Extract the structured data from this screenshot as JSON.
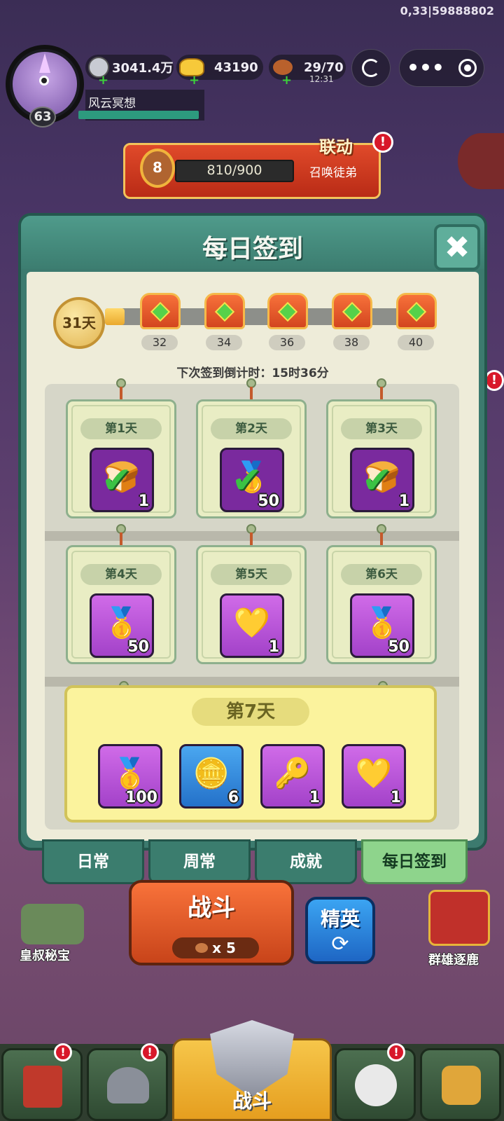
{
  "debug_text": "0,33|59888802",
  "player": {
    "level": "63",
    "name": "风云冥想"
  },
  "resources": {
    "silver": "3041.4万",
    "gold": "43190",
    "stamina": "29/70",
    "stamina_timer": "12:31"
  },
  "banner": {
    "medal_level": "8",
    "progress": "810/900",
    "tag": "联动",
    "action": "召唤徒弟",
    "alert": "!"
  },
  "dialog": {
    "title": "每日签到",
    "close_icon": "✖",
    "streak_days": "31天",
    "chests": [
      "32",
      "34",
      "36",
      "38",
      "40"
    ],
    "countdown": "下次签到倒计时：15时36分",
    "days": [
      {
        "label": "第1天",
        "count": "1",
        "icon": "bread-icon",
        "claimed": true
      },
      {
        "label": "第2天",
        "count": "50",
        "icon": "gold-ingot-icon",
        "claimed": true
      },
      {
        "label": "第3天",
        "count": "1",
        "icon": "bread-icon",
        "claimed": true
      },
      {
        "label": "第4天",
        "count": "50",
        "icon": "gold-ingot-icon",
        "claimed": false
      },
      {
        "label": "第5天",
        "count": "1",
        "icon": "heart-coin-icon",
        "claimed": false
      },
      {
        "label": "第6天",
        "count": "50",
        "icon": "gold-ingot-icon",
        "claimed": false
      }
    ],
    "day7": {
      "label": "第7天",
      "rewards": [
        {
          "icon": "gold-ingot-icon",
          "count": "100"
        },
        {
          "icon": "silver-coin-icon",
          "count": "6"
        },
        {
          "icon": "key-icon",
          "count": "1"
        },
        {
          "icon": "heart-coin-icon",
          "count": "1"
        }
      ]
    }
  },
  "tabs": [
    "日常",
    "周常",
    "成就",
    "每日签到"
  ],
  "active_tab": "每日签到",
  "lower": {
    "fight": "战斗",
    "fight_cost": "x 5",
    "elite": "精英",
    "left_label": "皇叔秘宝",
    "right_label": "群雄逐鹿",
    "nav_center": "战斗"
  },
  "colors": {
    "dialog_green": "#3c7a6e",
    "panel_cream": "#eeecd9",
    "active_tab": "#8ed48c",
    "day7_yellow": "#fbf39d"
  }
}
